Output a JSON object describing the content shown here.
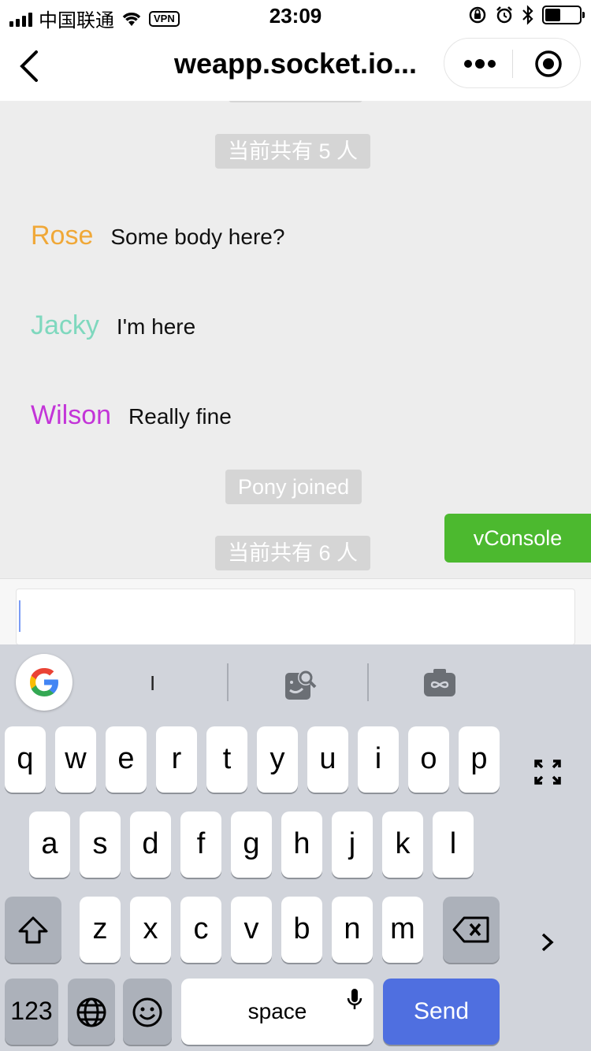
{
  "status_bar": {
    "carrier": "中国联通",
    "vpn": "VPN",
    "time": "23:09"
  },
  "nav": {
    "title": "weapp.socket.io..."
  },
  "chat": {
    "system_messages": [
      "当前共有 5 人",
      "Pony joined",
      "当前共有 6 人"
    ],
    "messages": [
      {
        "name": "Rose",
        "text": "Some body here?",
        "color": "#f0a838"
      },
      {
        "name": "Jacky",
        "text": "I'm here",
        "color": "#7fd8be"
      },
      {
        "name": "Wilson",
        "text": "Really fine",
        "color": "#c334d8"
      }
    ]
  },
  "vconsole": {
    "label": "vConsole",
    "color": "#4cb92f"
  },
  "input": {
    "value": "",
    "placeholder": ""
  },
  "keyboard": {
    "suggestion": "I",
    "row1": [
      "q",
      "w",
      "e",
      "r",
      "t",
      "y",
      "u",
      "i",
      "o",
      "p"
    ],
    "row2": [
      "a",
      "s",
      "d",
      "f",
      "g",
      "h",
      "j",
      "k",
      "l"
    ],
    "row3": [
      "z",
      "x",
      "c",
      "v",
      "b",
      "n",
      "m"
    ],
    "numbers_label": "123",
    "space_label": "space",
    "send_label": "Send",
    "send_color": "#4f6fe0"
  }
}
